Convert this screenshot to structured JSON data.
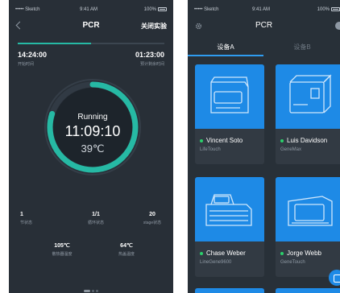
{
  "left": {
    "status": {
      "carrier": "••••• Sketch",
      "time": "9:41 AM",
      "battery": "100%"
    },
    "nav": {
      "title": "PCR",
      "action": "关闭实验"
    },
    "progress_fraction": 0.5,
    "start": {
      "time": "14:24:00",
      "label": "开始时间"
    },
    "remaining": {
      "time": "01:23:00",
      "label": "预计剩余时间"
    },
    "ring": {
      "status": "Running",
      "time": "11:09:10",
      "temp": "39℃",
      "progress_fraction": 0.8
    },
    "stats": [
      {
        "value": "1",
        "label": "节状态"
      },
      {
        "value": "1/1",
        "label": "循环状态"
      },
      {
        "value": "20",
        "label": "stage状态"
      }
    ],
    "temps": [
      {
        "value": "105℃",
        "label": "散热器温度"
      },
      {
        "value": "64℃",
        "label": "热盖温度"
      }
    ],
    "accent": "#26b9a4"
  },
  "right": {
    "status": {
      "carrier": "••••• Sketch",
      "time": "9:41 AM",
      "battery": "100%"
    },
    "nav": {
      "title": "PCR"
    },
    "tabs": [
      {
        "label": "设备A"
      },
      {
        "label": "设备B"
      }
    ],
    "devices": [
      {
        "name": "Vincent Soto",
        "model": "LifeTouch"
      },
      {
        "name": "Luis Davidson",
        "model": "GeneMax"
      },
      {
        "name": "Chase Weber",
        "model": "LineGene9600"
      },
      {
        "name": "Jorge Webb",
        "model": "GeneTouch"
      }
    ],
    "accent": "#1e8ae6",
    "online_color": "#2bd06b"
  }
}
